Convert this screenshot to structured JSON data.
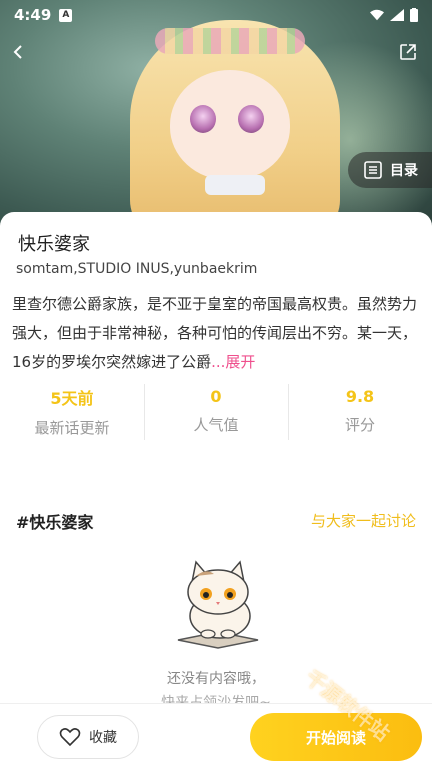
{
  "status_bar": {
    "time": "4:49",
    "notification_badge": "A"
  },
  "cover": {
    "toc_label": "目录"
  },
  "comic": {
    "title": "快乐婆家",
    "authors": "somtam,STUDIO INUS,yunbaekrim",
    "description": "里查尔德公爵家族，是不亚于皇室的帝国最高权贵。虽然势力强大，但由于非常神秘，各种可怕的传闻层出不穷。某一天，16岁的罗埃尔突然嫁进了公爵",
    "expand_label": "...展开"
  },
  "stats": [
    {
      "value": "5天前",
      "caption": "最新话更新"
    },
    {
      "value": "0",
      "caption": "人气值"
    },
    {
      "value": "9.8",
      "caption": "评分"
    }
  ],
  "discussion": {
    "topic": "#快乐婆家",
    "link": "与大家一起讨论",
    "empty_line1": "还没有内容哦，",
    "empty_line2": "快来占领沙发吧~"
  },
  "bottom_bar": {
    "favorite_label": "收藏",
    "read_label": "开始阅读"
  },
  "watermark": "千源软件站",
  "colors": {
    "accent": "#f4c418",
    "expand": "#ef4f8d",
    "read_button": "#fbbd10"
  },
  "icons": [
    "back-icon",
    "share-icon",
    "list-icon",
    "heart-icon",
    "wifi-icon",
    "signal-icon",
    "battery-icon"
  ]
}
